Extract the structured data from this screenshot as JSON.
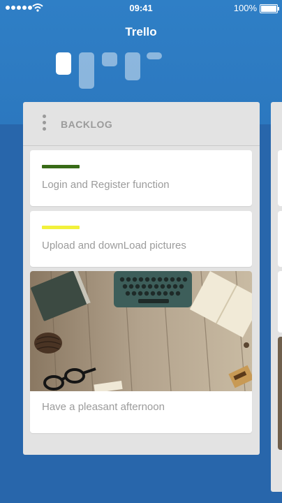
{
  "status_bar": {
    "time": "09:41",
    "battery_percent": "100%",
    "signal_icon": "signal-dots-icon",
    "wifi_icon": "wifi-icon",
    "battery_icon": "battery-icon"
  },
  "app": {
    "title": "Trello",
    "logo_icon": "trello-logo-icon"
  },
  "board": {
    "lists": [
      {
        "title": "BACKLOG",
        "cards": [
          {
            "text": "Login and Register function",
            "label_color": "#386b17"
          },
          {
            "text": "Upload and downLoad pictures",
            "label_color": "#f2f13b"
          },
          {
            "text": "Have a pleasant afternoon",
            "cover": "desk-typewriter-photo"
          }
        ]
      }
    ]
  },
  "colors": {
    "header_blue": "#2f7fc6",
    "board_blue": "#2866ab",
    "list_gray": "#e3e3e3",
    "text_gray": "#9b9b9b"
  }
}
